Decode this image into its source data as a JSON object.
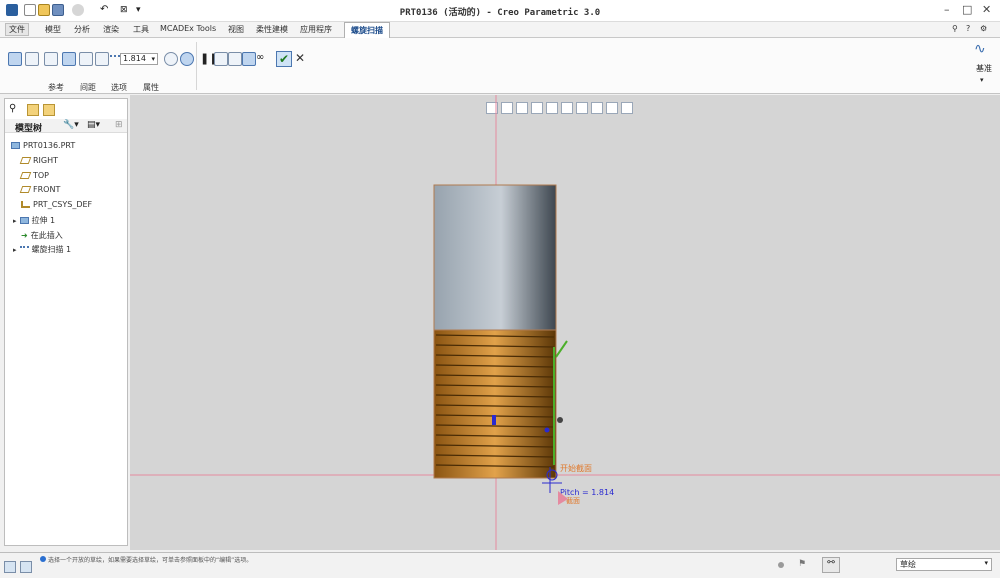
{
  "title": "PRT0136 (活动的) - Creo Parametric 3.0",
  "menu": {
    "tabs": [
      "文件",
      "模型",
      "分析",
      "渲染",
      "工具",
      "MCADEx Tools",
      "视图",
      "柔性建模",
      "应用程序",
      "螺旋扫描"
    ],
    "active_tab": "螺旋扫描"
  },
  "ribbon": {
    "pitch_value": "1.814",
    "subtabs": [
      "参考",
      "间距",
      "选项",
      "属性"
    ],
    "datum_label": "基准"
  },
  "sidebar": {
    "header": "模型树",
    "root": "PRT0136.PRT",
    "items": [
      "RIGHT",
      "TOP",
      "FRONT",
      "PRT_CSYS_DEF",
      "拉伸 1",
      "在此插入",
      "螺旋扫描 1"
    ]
  },
  "canvas": {
    "pitch_label": "Pitch = 1.814",
    "start_label": "开始截面",
    "end_label": "截面"
  },
  "status": {
    "message": "选择一个开放的草绘，如果需要选择草绘，可单击参照面板中的“编辑”选项。",
    "filter_value": "草绘"
  },
  "colors": {
    "accent": "#1a4a8a",
    "thread": "#b8761f",
    "shaft": "#7e8a96",
    "profile": "#4caf2a"
  }
}
